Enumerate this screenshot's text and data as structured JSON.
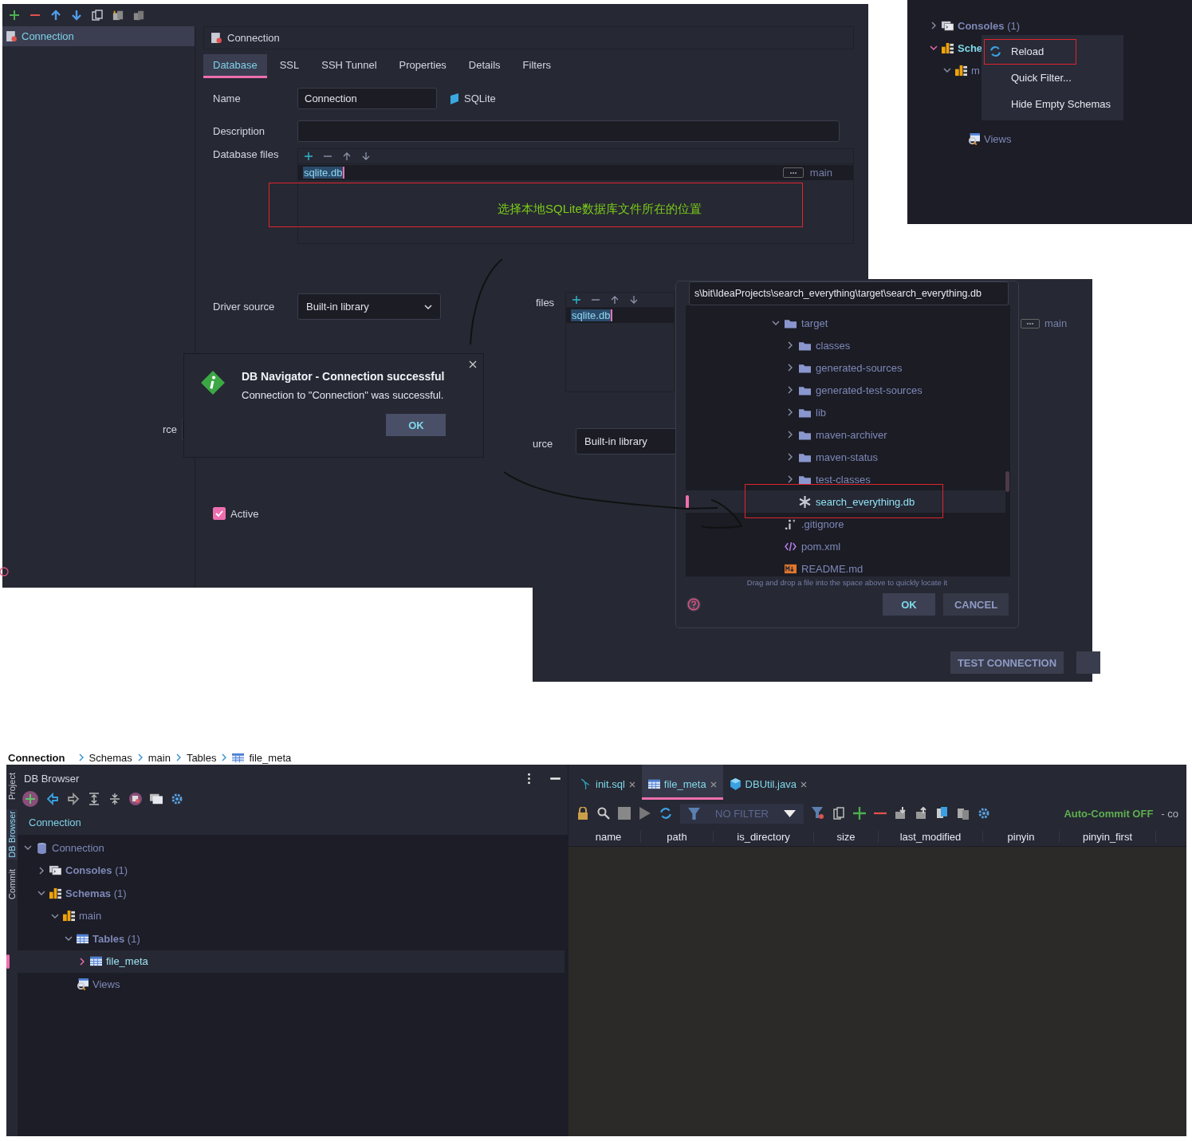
{
  "config_dialog": {
    "sidebar_items": [
      {
        "label": "Connection",
        "selected": true
      }
    ],
    "header": "Connection",
    "tabs": [
      {
        "label": "Database",
        "selected": true
      },
      {
        "label": "SSL",
        "selected": false
      },
      {
        "label": "SSH Tunnel",
        "selected": false
      },
      {
        "label": "Properties",
        "selected": false
      },
      {
        "label": "Details",
        "selected": false
      },
      {
        "label": "Filters",
        "selected": false
      }
    ],
    "name_label": "Name",
    "name_value": "Connection",
    "db_type": "SQLite",
    "description_label": "Description",
    "files_label": "Database files",
    "files": [
      {
        "path": "sqlite.db",
        "schema": "main"
      }
    ],
    "driver_label": "Driver source",
    "driver_value": "Built-in library",
    "cut_label": "rce",
    "active": {
      "label": "Active",
      "checked": true
    }
  },
  "annotation": "选择本地SQLite数据库文件所在的位置",
  "menu_shot": {
    "tree": [
      {
        "label": "Consoles",
        "count": "(1)",
        "kind": "consoles"
      },
      {
        "label": "Sche",
        "kind": "schemas"
      },
      {
        "label": "m",
        "kind": "schema"
      },
      {
        "label": "Views",
        "kind": "views"
      }
    ],
    "menu": [
      {
        "label": "Reload",
        "icon": true
      },
      {
        "label": "Quick Filter...",
        "icon": false
      },
      {
        "label": "Hide Empty Schemas",
        "icon": false
      }
    ]
  },
  "info_dialog": {
    "title": "DB Navigator - Connection successful",
    "message": "Connection to \"Connection\" was successful.",
    "button": "OK"
  },
  "second_dialog": {
    "files_label": "files",
    "file": "sqlite.db",
    "schema": "main",
    "source_label": "urce",
    "source_value": "Built-in library",
    "test_button": "TEST CONNECTION"
  },
  "file_chooser": {
    "path": "s\\bit\\IdeaProjects\\search_everything\\target\\search_everything.db",
    "tree": [
      {
        "label": "target",
        "kind": "folder",
        "expanded": true,
        "selected": false,
        "children": [
          {
            "label": "classes",
            "kind": "folder",
            "expanded": false,
            "selected": false
          },
          {
            "label": "generated-sources",
            "kind": "folder",
            "expanded": false,
            "selected": false
          },
          {
            "label": "generated-test-sources",
            "kind": "folder",
            "expanded": false,
            "selected": false
          },
          {
            "label": "lib",
            "kind": "folder",
            "expanded": false,
            "selected": false
          },
          {
            "label": "maven-archiver",
            "kind": "folder",
            "expanded": false,
            "selected": false
          },
          {
            "label": "maven-status",
            "kind": "folder",
            "expanded": false,
            "selected": false
          },
          {
            "label": "test-classes",
            "kind": "folder",
            "expanded": false,
            "selected": false
          },
          {
            "label": "search_everything.db",
            "kind": "db",
            "selected": true
          }
        ]
      },
      {
        "label": ".gitignore",
        "kind": "ignore",
        "selected": false
      },
      {
        "label": "pom.xml",
        "kind": "xml",
        "selected": false
      },
      {
        "label": "README.md",
        "kind": "md",
        "selected": false
      }
    ],
    "hint": "Drag and drop a file into the space above to quickly locate it",
    "ok": "OK",
    "cancel": "CANCEL"
  },
  "ide": {
    "breadcrumb": [
      {
        "label": "Connection",
        "kind": "root"
      },
      {
        "label": "Schemas",
        "kind": "plain"
      },
      {
        "label": "main",
        "kind": "plain"
      },
      {
        "label": "Tables",
        "kind": "plain"
      },
      {
        "label": "file_meta",
        "kind": "table"
      }
    ],
    "side_tabs": [
      {
        "label": "Project",
        "selected": false
      },
      {
        "label": "DB Browser",
        "selected": true
      },
      {
        "label": "Commit",
        "selected": false
      }
    ],
    "panel_title": "DB Browser",
    "connection_header": "Connection",
    "tree": [
      {
        "label": "Connection",
        "kind": "connection",
        "expanded": true,
        "selected": false,
        "children": [
          {
            "label": "Consoles",
            "count": "(1)",
            "kind": "consoles",
            "expanded": false,
            "selected": false
          },
          {
            "label": "Schemas",
            "count": "(1)",
            "kind": "schemas",
            "expanded": true,
            "selected": false,
            "children": [
              {
                "label": "main",
                "kind": "schema",
                "expanded": true,
                "selected": false,
                "children": [
                  {
                    "label": "Tables",
                    "count": "(1)",
                    "kind": "tables",
                    "expanded": true,
                    "selected": false,
                    "children": [
                      {
                        "label": "file_meta",
                        "kind": "table",
                        "expanded": false,
                        "selected": true
                      }
                    ]
                  },
                  {
                    "label": "Views",
                    "kind": "views",
                    "selected": false
                  }
                ]
              }
            ]
          }
        ]
      }
    ],
    "editor_tabs": [
      {
        "label": "init.sql",
        "kind": "sql",
        "selected": false
      },
      {
        "label": "file_meta",
        "kind": "table",
        "selected": true
      },
      {
        "label": "DBUtil.java",
        "kind": "java",
        "selected": false
      }
    ],
    "filter": "NO FILTER",
    "auto_commit": "Auto-Commit OFF",
    "auto_commit_tail": "- co",
    "columns": [
      "name",
      "path",
      "is_directory",
      "size",
      "last_modified",
      "pinyin",
      "pinyin_first"
    ]
  }
}
